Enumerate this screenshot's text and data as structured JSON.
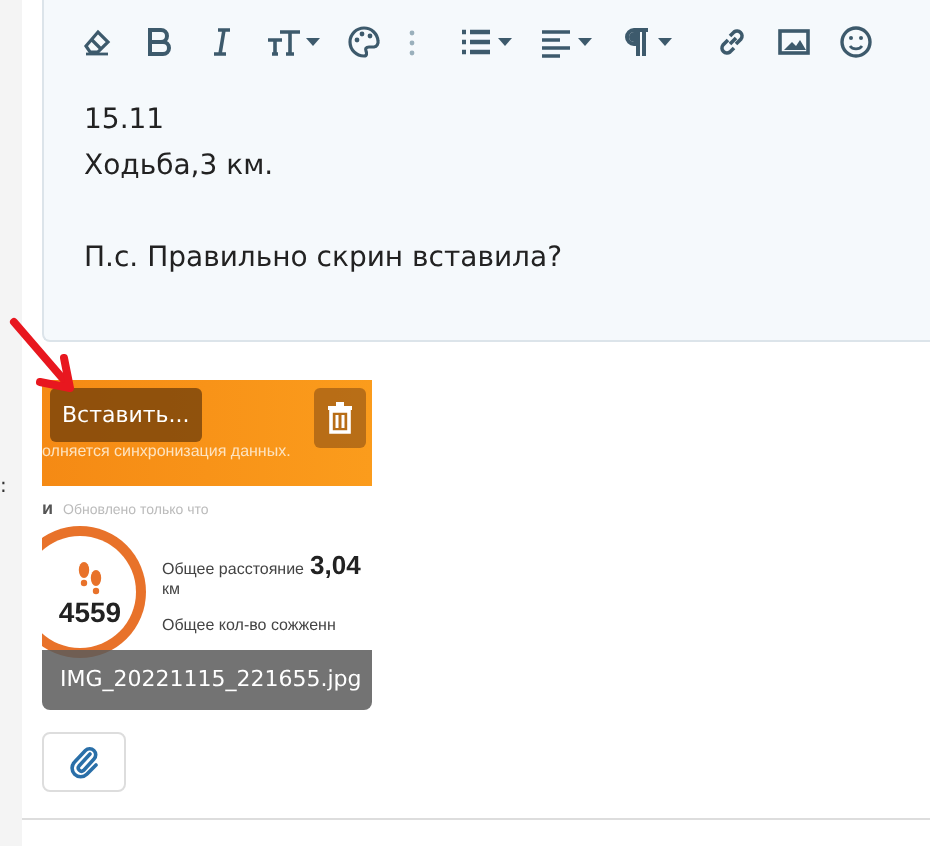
{
  "toolbar": [
    {
      "kind": "eraser",
      "caret": false
    },
    {
      "kind": "bold",
      "caret": false
    },
    {
      "kind": "italic",
      "caret": false
    },
    {
      "kind": "textsize",
      "caret": true
    },
    {
      "kind": "palette",
      "caret": false
    },
    {
      "kind": "more",
      "caret": false
    },
    {
      "kind": "list",
      "caret": true
    },
    {
      "kind": "align",
      "caret": true
    },
    {
      "kind": "paragraph",
      "caret": true
    },
    {
      "kind": "link",
      "caret": false
    },
    {
      "kind": "image",
      "caret": false
    },
    {
      "kind": "emoji",
      "caret": false
    }
  ],
  "editor": {
    "paragraphs": [
      {
        "lines": [
          "15.11",
          "Ходьба,3 км."
        ]
      },
      {
        "lines": [
          "П.с. Правильно скрин вставила?"
        ]
      }
    ]
  },
  "side_mark": ":",
  "attachment": {
    "insert_button": "Вставить...",
    "filename": "IMG_20221115_221655.jpg",
    "preview": {
      "sync_text": "олняется синхронизация данных.",
      "header_letter": "и",
      "updated": "Обновлено только что",
      "steps": "4559",
      "distance_label": "Общее расстояние",
      "distance_value": "3,04",
      "distance_unit": "км",
      "calories_label": "Общее кол-во сожженн"
    }
  }
}
